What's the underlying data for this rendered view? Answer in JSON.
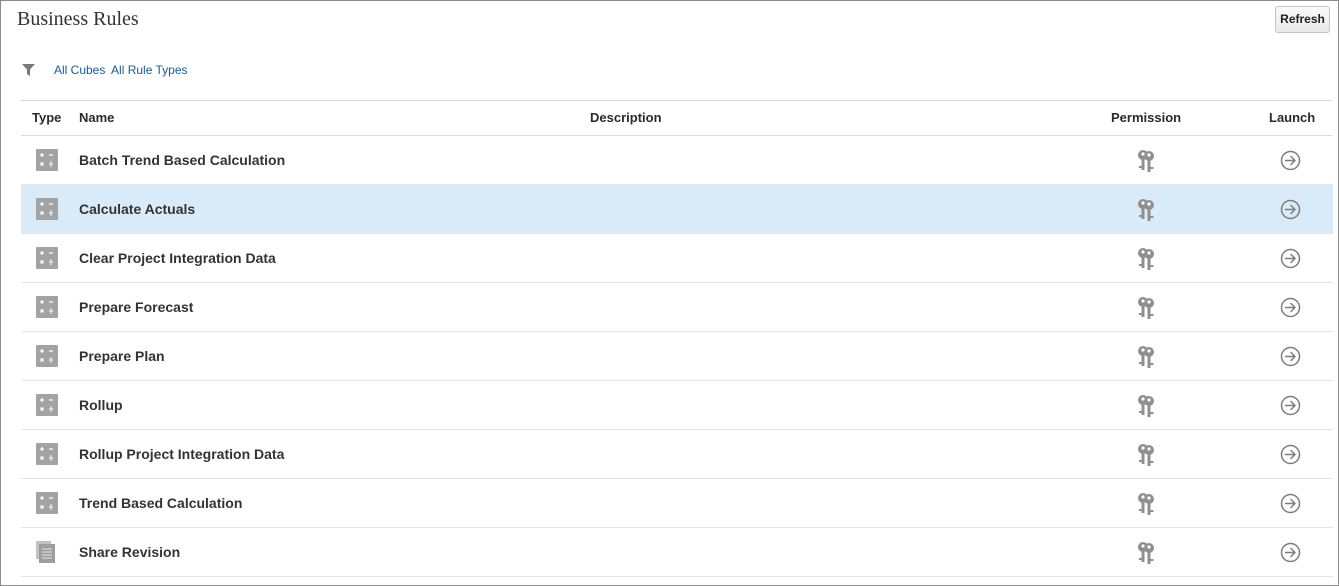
{
  "page": {
    "title": "Business Rules"
  },
  "toolbar": {
    "refresh_label": "Refresh"
  },
  "filters": {
    "cubes": "All Cubes",
    "rule_types": "All Rule Types"
  },
  "table": {
    "headers": {
      "type": "Type",
      "name": "Name",
      "description": "Description",
      "permission": "Permission",
      "launch": "Launch"
    },
    "rows": [
      {
        "type": "calc-script-icon",
        "name": "Batch Trend Based Calculation",
        "description": "",
        "selected": false
      },
      {
        "type": "calc-script-icon",
        "name": "Calculate Actuals",
        "description": "",
        "selected": true
      },
      {
        "type": "calc-script-icon",
        "name": "Clear Project Integration Data",
        "description": "",
        "selected": false
      },
      {
        "type": "calc-script-icon",
        "name": "Prepare Forecast",
        "description": "",
        "selected": false
      },
      {
        "type": "calc-script-icon",
        "name": "Prepare Plan",
        "description": "",
        "selected": false
      },
      {
        "type": "calc-script-icon",
        "name": "Rollup",
        "description": "",
        "selected": false
      },
      {
        "type": "calc-script-icon",
        "name": "Rollup Project Integration Data",
        "description": "",
        "selected": false
      },
      {
        "type": "calc-script-icon",
        "name": "Trend Based Calculation",
        "description": "",
        "selected": false
      },
      {
        "type": "document-icon",
        "name": "Share Revision",
        "description": "",
        "selected": false
      }
    ]
  },
  "colors": {
    "link": "#145c9e",
    "selected_row": "#d9ebf9",
    "icon": "#9a9a9a"
  }
}
